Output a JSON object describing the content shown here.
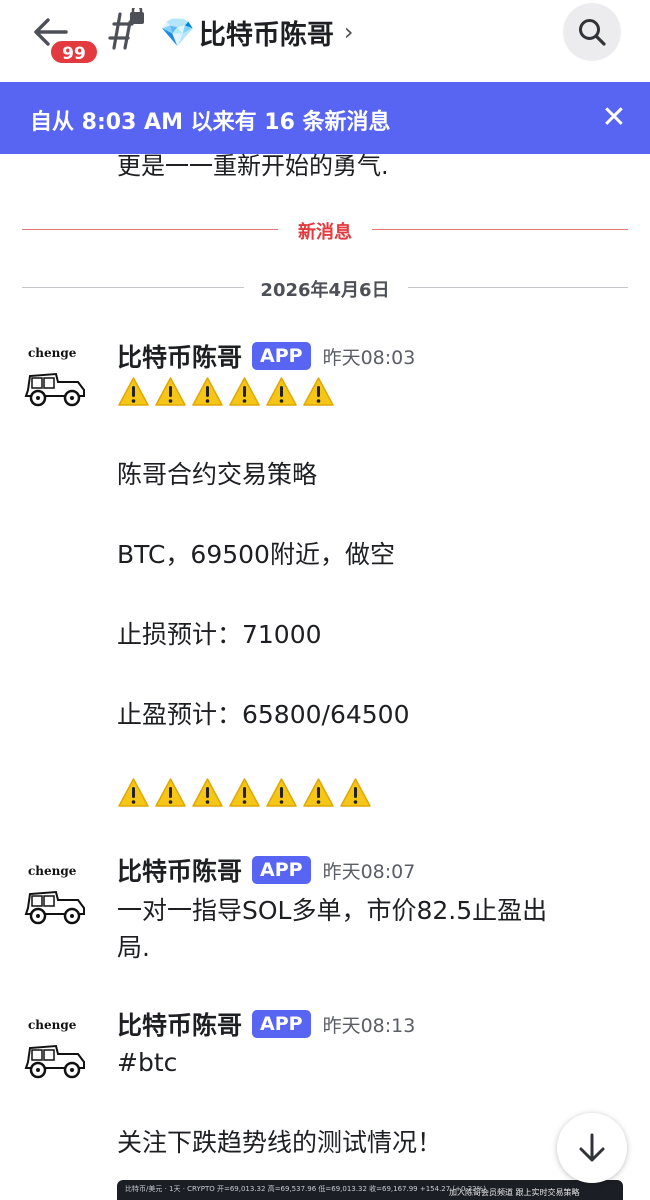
{
  "header": {
    "unread_badge": "99",
    "channel_emoji": "💎",
    "channel_name": "比特币陈哥",
    "chevron": "›",
    "icons": {
      "back": "arrow-left-icon",
      "channel": "locked-hash-icon",
      "search": "search-icon"
    }
  },
  "new_messages_bar": {
    "text": "自从 8:03 AM 以来有 16 条新消息",
    "close": "✕"
  },
  "previous_message_tail": "更是一一重新开始的勇气.",
  "divider_new": "新消息",
  "divider_date": "2026年4月6日",
  "messages": [
    {
      "avatar_text": "chenge",
      "author": "比特币陈哥",
      "tag": "APP",
      "time": "昨天08:03",
      "lines": [
        "陈哥合约交易策略",
        "BTC，69500附近，做空",
        "止损预计：71000",
        "止盈预计：65800/64500"
      ]
    },
    {
      "avatar_text": "chenge",
      "author": "比特币陈哥",
      "tag": "APP",
      "time": "昨天08:07",
      "lines": [
        "一对一指导SOL多单，市价82.5止盈出",
        "局."
      ]
    },
    {
      "avatar_text": "chenge",
      "author": "比特币陈哥",
      "tag": "APP",
      "time": "昨天08:13",
      "lines": [
        "#btc",
        "关注下跌趋势线的测试情况！"
      ]
    }
  ],
  "attachment": {
    "caption": "比特币/美元 · 1天 · CRYPTO  开=69,013.32  高=69,537.96  低=69,013.32  收=69,167.99 +154.27 (+0.22%)",
    "promo": "加入陈哥会员频道  跟上实时交易策略"
  },
  "colors": {
    "accent": "#5865f2",
    "new_divider": "#e23a3f",
    "badge": "#e23a3f",
    "warning": "#f5c518"
  }
}
